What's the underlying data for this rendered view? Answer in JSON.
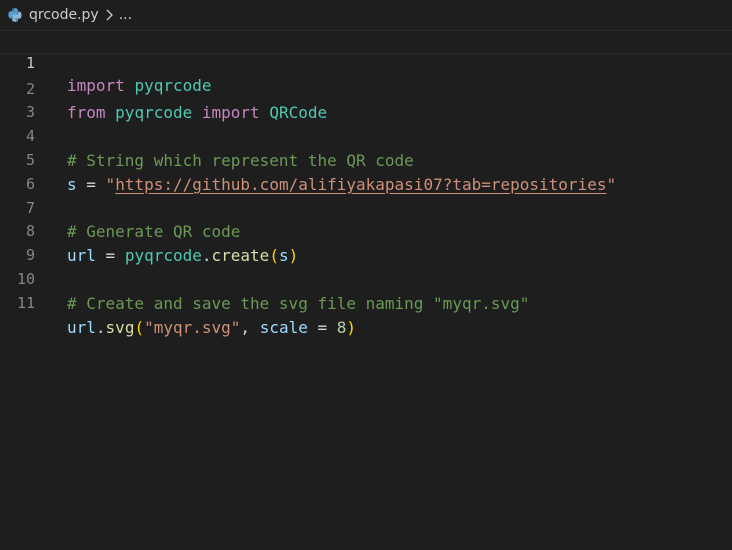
{
  "breadcrumb": {
    "file": "qrcode.py",
    "more": "...",
    "icon": "python-file-icon"
  },
  "colors": {
    "background": "#1e1e1e",
    "keyword": "#c586c0",
    "module": "#4ec9b0",
    "variable": "#9cdcfe",
    "function": "#dcdcaa",
    "string": "#ce9178",
    "comment": "#6a9955",
    "number": "#b5cea8"
  },
  "editor": {
    "current_line": 1,
    "lines": [
      {
        "number": "1",
        "tokens": [
          "import",
          " ",
          "pyqrcode"
        ]
      },
      {
        "number": "2",
        "tokens": [
          "from",
          " ",
          "pyqrcode",
          " ",
          "import",
          " ",
          "QRCode"
        ]
      },
      {
        "number": "3",
        "tokens": []
      },
      {
        "number": "4",
        "tokens": [
          "# String which represent the QR code"
        ]
      },
      {
        "number": "5",
        "tokens": [
          "s",
          " = ",
          "\"",
          "https://github.com/alifiyakapasi07?tab=repositories",
          "\""
        ]
      },
      {
        "number": "6",
        "tokens": []
      },
      {
        "number": "7",
        "tokens": [
          "# Generate QR code"
        ]
      },
      {
        "number": "8",
        "tokens": [
          "url",
          " = ",
          "pyqrcode",
          ".",
          "create",
          "(",
          "s",
          ")"
        ]
      },
      {
        "number": "9",
        "tokens": []
      },
      {
        "number": "10",
        "tokens": [
          "# Create and save the svg file naming \"myqr.svg\""
        ]
      },
      {
        "number": "11",
        "tokens": [
          "url",
          ".",
          "svg",
          "(",
          "\"myqr.svg\"",
          ", ",
          "scale",
          " = ",
          "8",
          ")"
        ]
      }
    ]
  }
}
